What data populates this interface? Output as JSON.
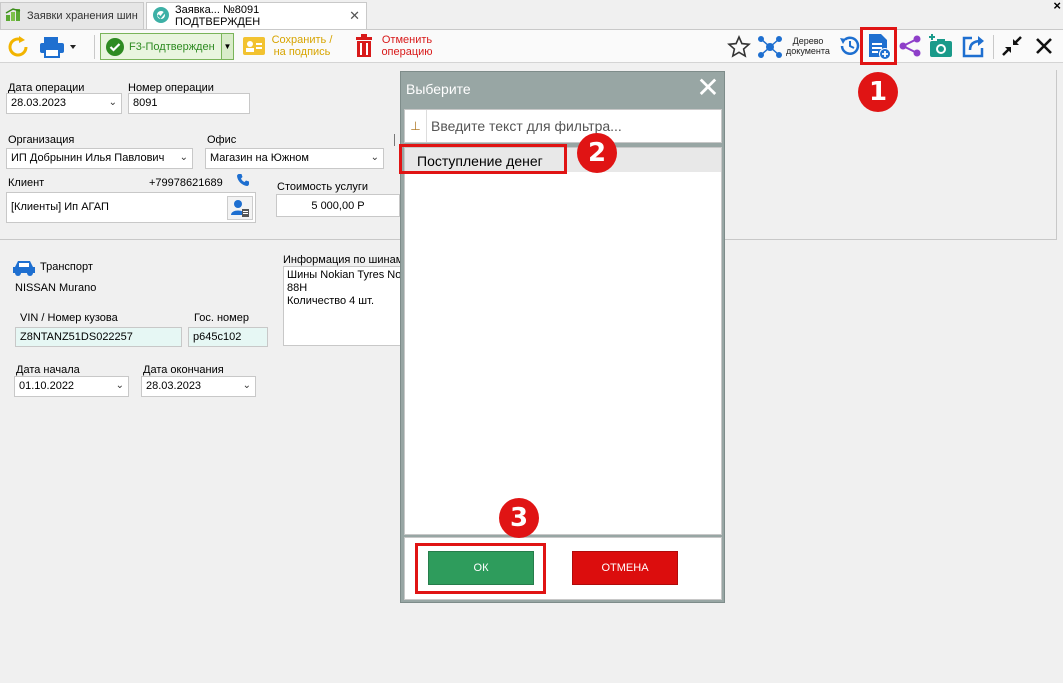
{
  "tabs": [
    {
      "label": "Заявки хранения шин",
      "active": false
    },
    {
      "label": "Заявка... №8091 ПОДТВЕРЖДЕН",
      "active": true
    }
  ],
  "window_close": "×",
  "toolbar": {
    "status_label": "F3-Подтвержден",
    "save_sign_line1": "Сохранить /",
    "save_sign_line2": "на подпись",
    "cancel_op_line1": "Отменить",
    "cancel_op_line2": "операцию",
    "doc_tree_line1": "Дерево",
    "doc_tree_line2": "документа"
  },
  "form": {
    "op_date_label": "Дата операции",
    "op_date_value": "28.03.2023",
    "op_number_label": "Номер операции",
    "op_number_value": "8091",
    "org_label": "Организация",
    "org_value": "ИП Добрынин Илья Павлович",
    "office_label": "Офис",
    "office_value": "Магазин на Южном",
    "client_label": "Клиент",
    "client_phone": "+79978621689",
    "client_value": "[Клиенты] Ип АГАП",
    "service_cost_label": "Стоимость услуги",
    "service_cost_value": "5 000,00 Р"
  },
  "transport": {
    "title": "Транспорт",
    "car": "NISSAN Murano",
    "vin_label": "VIN / Номер кузова",
    "vin_value": "Z8NTANZ51DS022257",
    "plate_label": "Гос. номер",
    "plate_value": "р645с102",
    "start_label": "Дата начала",
    "start_value": "01.10.2022",
    "end_label": "Дата окончания",
    "end_value": "28.03.2023",
    "tires_label": "Информация по шинам",
    "tires_line1": "Шины Nokian Tyres Nor",
    "tires_line2": "88H",
    "tires_line3": "Количество 4 шт."
  },
  "modal": {
    "title": "Выберите",
    "close": "✕",
    "filter_placeholder": "Введите текст для фильтра...",
    "items": [
      "Поступление денег"
    ],
    "ok_label": "ОК",
    "cancel_label": "ОТМЕНА"
  },
  "annotations": {
    "step1": "1",
    "step2": "2",
    "step3": "3",
    "color": "#e01414"
  },
  "colors": {
    "accent_blue": "#1e6fd0",
    "status_green": "#2e8b22",
    "ok_green": "#2e9c5c",
    "cancel_red": "#dc0d0d",
    "modal_header": "#98a6a4"
  }
}
